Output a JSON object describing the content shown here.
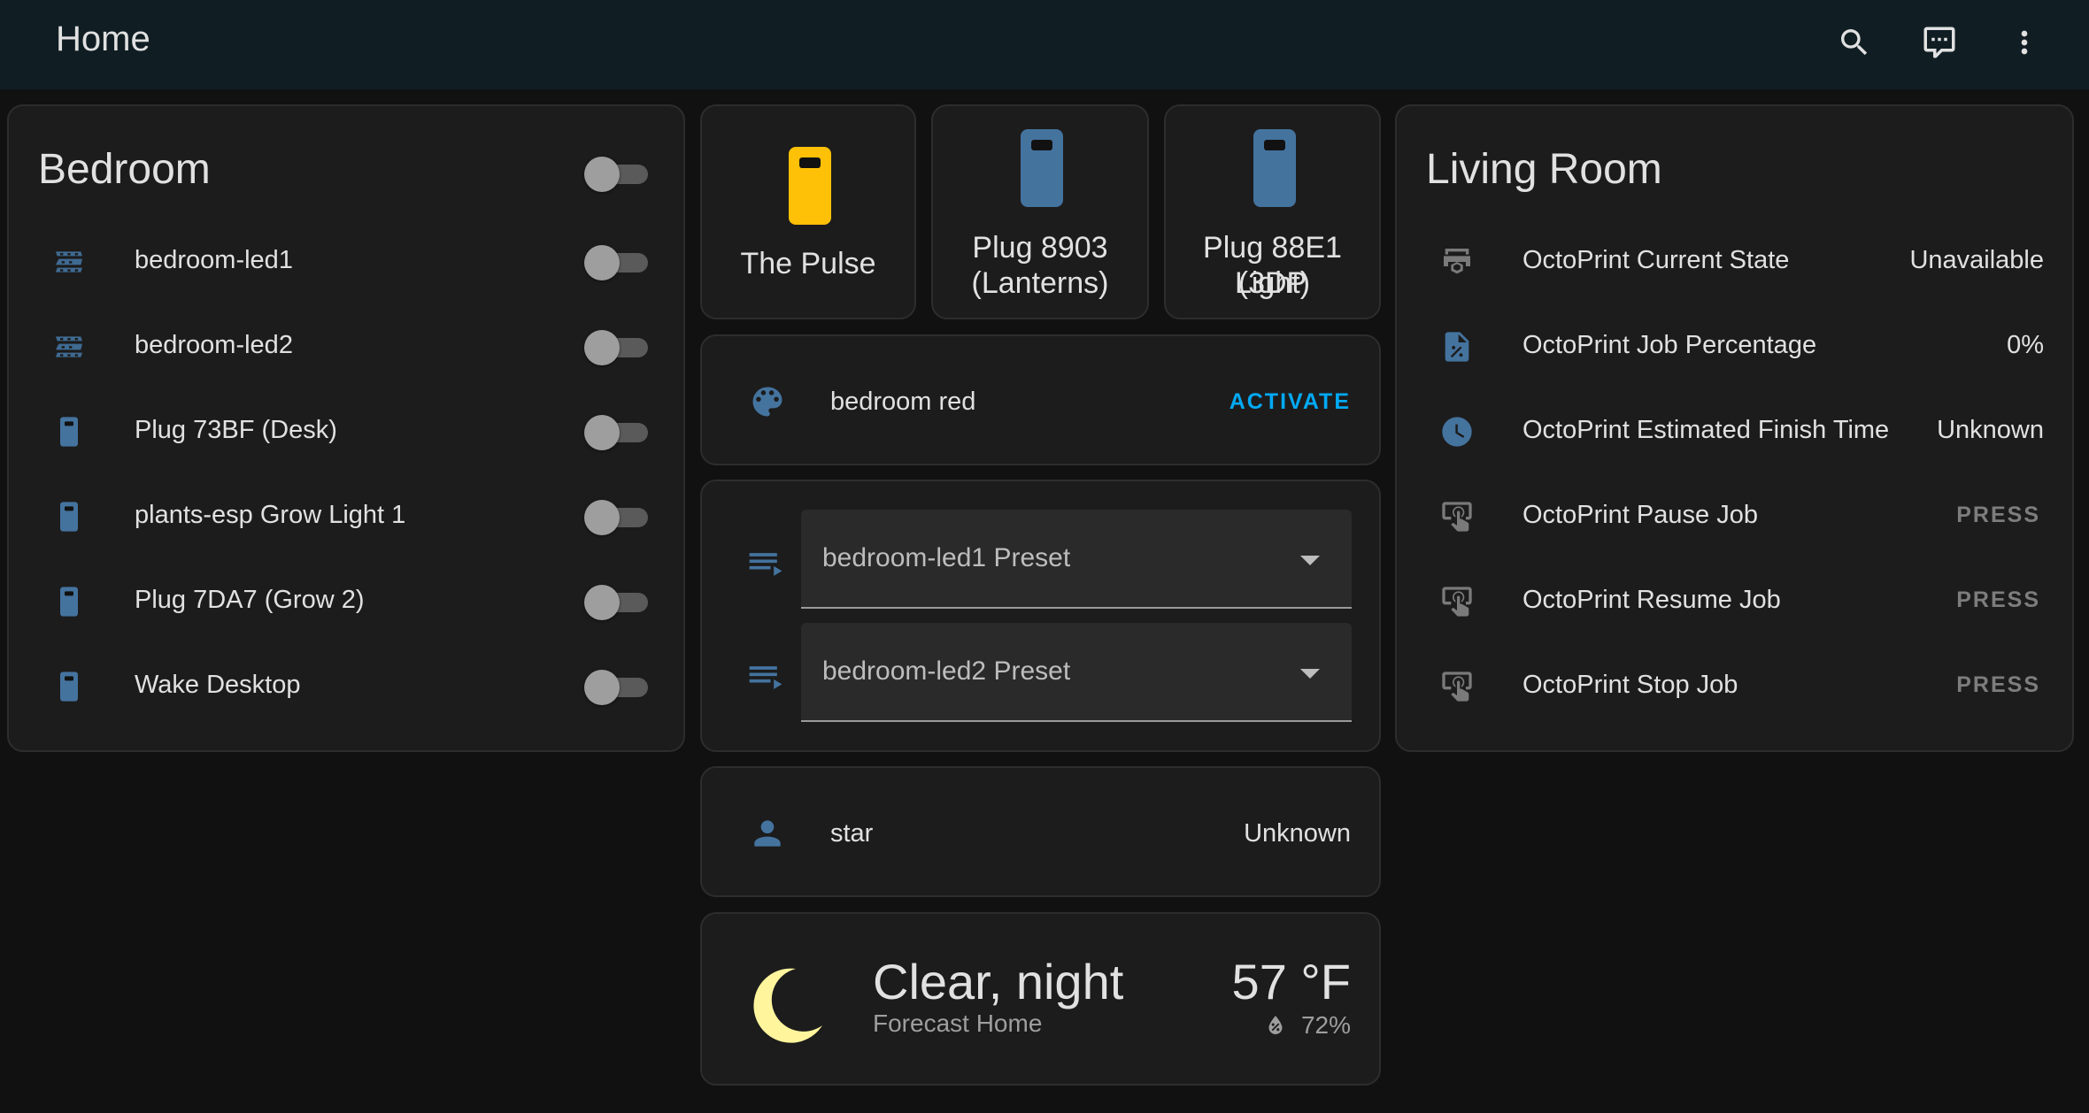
{
  "header": {
    "title": "Home",
    "icons": [
      "search-icon",
      "assist-chat-icon",
      "more-vert-icon"
    ]
  },
  "bedroom": {
    "title": "Bedroom",
    "master_toggle": false,
    "items": [
      {
        "label": "bedroom-led1",
        "icon": "led-strip-icon",
        "on": false
      },
      {
        "label": "bedroom-led2",
        "icon": "led-strip-icon",
        "on": false
      },
      {
        "label": "Plug 73BF (Desk)",
        "icon": "power-socket-icon",
        "on": false
      },
      {
        "label": "plants-esp Grow Light 1",
        "icon": "power-socket-icon",
        "on": false
      },
      {
        "label": "Plug 7DA7 (Grow 2)",
        "icon": "power-socket-icon",
        "on": false
      },
      {
        "label": "Wake Desktop",
        "icon": "power-socket-icon",
        "on": false
      }
    ]
  },
  "tiles": [
    {
      "name": "The Pulse",
      "icon": "power-socket-icon",
      "color": "#ffc107"
    },
    {
      "name_line1": "Plug 8903",
      "name_line2": "(Lanterns)",
      "icon": "power-socket-icon",
      "color": "#44739e"
    },
    {
      "name_line1": "Plug 88E1 (3DP",
      "name_line2": "Light)",
      "icon": "power-socket-icon",
      "color": "#44739e"
    }
  ],
  "scene": {
    "label": "bedroom red",
    "action": "ACTIVATE",
    "icon": "palette-icon"
  },
  "selects": [
    {
      "label": "bedroom-led1 Preset",
      "icon": "playlist-play-icon"
    },
    {
      "label": "bedroom-led2 Preset",
      "icon": "playlist-play-icon"
    }
  ],
  "person": {
    "label": "star",
    "state": "Unknown",
    "icon": "account-icon"
  },
  "weather": {
    "condition": "Clear, night",
    "location": "Forecast Home",
    "temperature": "57 °F",
    "humidity": "72%",
    "icon": "moon-icon"
  },
  "living_room": {
    "title": "Living Room",
    "items": [
      {
        "label": "OctoPrint Current State",
        "value": "Unavailable",
        "icon": "printer-3d-icon"
      },
      {
        "label": "OctoPrint Job Percentage",
        "value": "0%",
        "icon": "file-percent-icon"
      },
      {
        "label": "OctoPrint Estimated Finish Time",
        "value": "Unknown",
        "icon": "clock-icon"
      },
      {
        "label": "OctoPrint Pause Job",
        "value": "PRESS",
        "icon": "gesture-tap-button-icon"
      },
      {
        "label": "OctoPrint Resume Job",
        "value": "PRESS",
        "icon": "gesture-tap-button-icon"
      },
      {
        "label": "OctoPrint Stop Job",
        "value": "PRESS",
        "icon": "gesture-tap-button-icon"
      }
    ]
  },
  "colors": {
    "accent": "#03a9f4",
    "icon_blue": "#44739e",
    "header_bg": "#101e24",
    "card_bg": "#1c1c1c"
  }
}
